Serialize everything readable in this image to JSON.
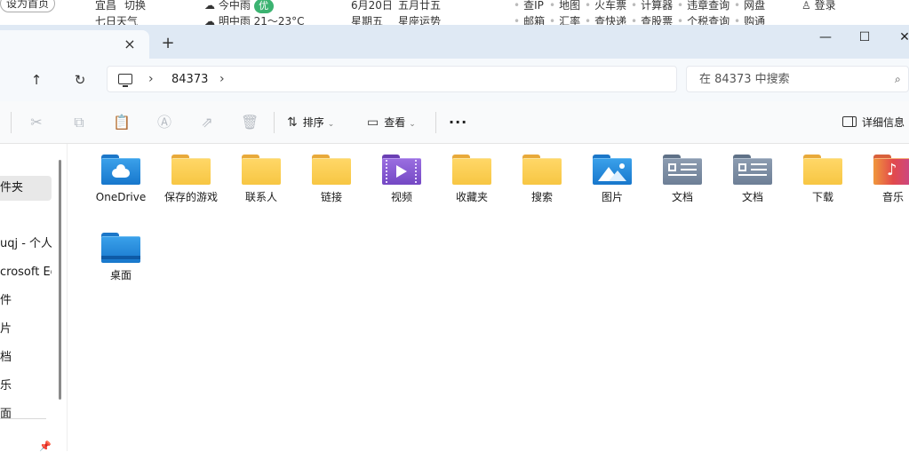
{
  "browser_strip": {
    "home_button": "设为首页",
    "city": "宜昌",
    "switch": "切换",
    "weather_forecast": "七日天气",
    "weather_today": "今中雨",
    "aqi_badge": "优",
    "weather_tomorrow": "明中雨 21～23°C",
    "date": "6月20日",
    "lunar": "五月廿五",
    "weekday": "星期五",
    "horoscope": "星座运势",
    "links_row1": [
      "查IP",
      "地图",
      "火车票",
      "计算器",
      "违章查询",
      "网盘"
    ],
    "links_row2": [
      "邮箱",
      "汇率",
      "查快递",
      "查股票",
      "个税查询",
      "购通"
    ],
    "login": "登录"
  },
  "window": {
    "tab_close_icon": "×",
    "tab_add_icon": "+",
    "controls": {
      "minimize": "—",
      "maximize": "☐",
      "close": "✕"
    }
  },
  "address_bar": {
    "up_icon": "↑",
    "refresh_icon": "↻",
    "breadcrumb": "84373",
    "chevron": "›",
    "search_placeholder": "在 84373 中搜索",
    "search_icon": "⌕"
  },
  "toolbar": {
    "sort_label": "排序",
    "view_label": "查看",
    "more_label": "···",
    "details_label": "详细信息"
  },
  "sidebar": {
    "items": [
      {
        "label": "件夹",
        "selected": true
      },
      {
        "label": ""
      },
      {
        "label": "uqj - 个人"
      },
      {
        "label": "crosoft Ed"
      },
      {
        "label": "件"
      },
      {
        "label": "片"
      },
      {
        "label": "档"
      },
      {
        "label": "乐"
      },
      {
        "label": "面"
      }
    ]
  },
  "items": [
    {
      "label": "OneDrive",
      "icon": "onedrive-folder-icon"
    },
    {
      "label": "保存的游戏",
      "icon": "folder-icon"
    },
    {
      "label": "联系人",
      "icon": "folder-icon"
    },
    {
      "label": "链接",
      "icon": "folder-icon"
    },
    {
      "label": "视频",
      "icon": "videos-folder-icon"
    },
    {
      "label": "收藏夹",
      "icon": "folder-icon"
    },
    {
      "label": "搜索",
      "icon": "folder-icon"
    },
    {
      "label": "图片",
      "icon": "pictures-folder-icon"
    },
    {
      "label": "文档",
      "icon": "documents-folder-icon"
    },
    {
      "label": "文档",
      "icon": "documents-folder-icon"
    },
    {
      "label": "下载",
      "icon": "folder-icon"
    },
    {
      "label": "音乐",
      "icon": "music-folder-icon"
    },
    {
      "label": "桌面",
      "icon": "desktop-folder-icon"
    }
  ]
}
